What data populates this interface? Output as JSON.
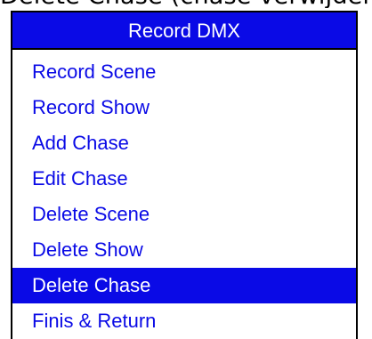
{
  "caption": "Delete Chase (chase verwijderen) to t",
  "menu": {
    "title": "Record DMX",
    "items": [
      {
        "label": "Record Scene",
        "selected": false
      },
      {
        "label": "Record Show",
        "selected": false
      },
      {
        "label": "Add Chase",
        "selected": false
      },
      {
        "label": "Edit Chase",
        "selected": false
      },
      {
        "label": "Delete Scene",
        "selected": false
      },
      {
        "label": "Delete Show",
        "selected": false
      },
      {
        "label": "Delete Chase",
        "selected": true
      },
      {
        "label": "Finis & Return",
        "selected": false
      }
    ]
  },
  "colors": {
    "accent": "#0a0ae6",
    "background": "#ffffff",
    "border": "#000000"
  }
}
